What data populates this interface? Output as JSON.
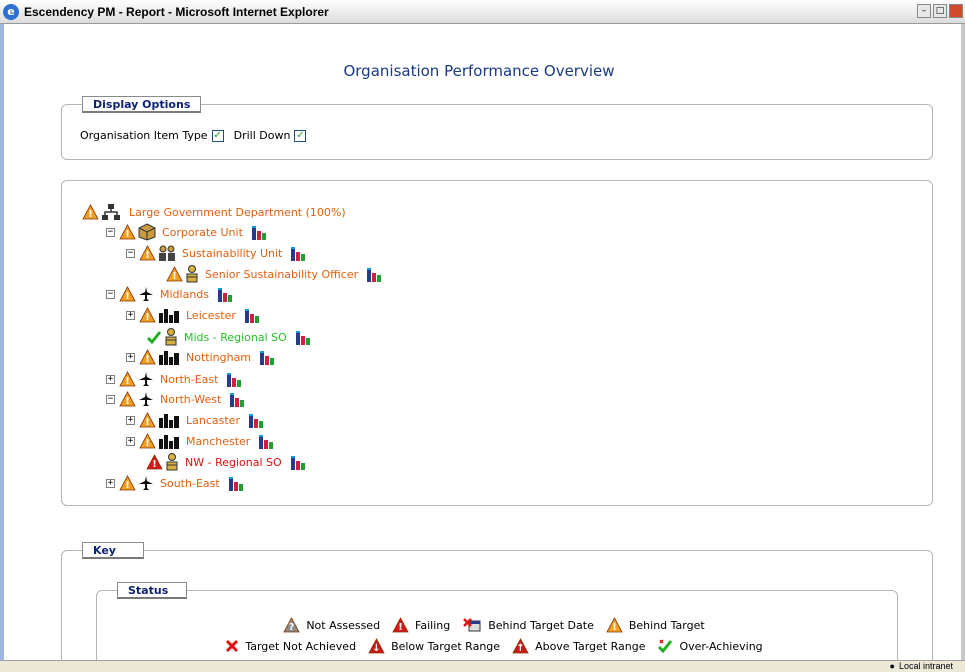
{
  "window": {
    "title": "Escendency PM - Report - Microsoft Internet Explorer"
  },
  "page": {
    "title": "Organisation Performance Overview"
  },
  "display_options": {
    "legend": "Display Options",
    "org_item_type_label": "Organisation Item Type",
    "org_item_type_checked": true,
    "drill_down_label": "Drill Down",
    "drill_down_checked": true
  },
  "tree": [
    {
      "label": "Large Government Department (100%)",
      "status": "behind-target",
      "type": "hierarchy-icon",
      "color": "orange",
      "expander": "",
      "chart": false
    },
    {
      "label": "Corporate Unit",
      "status": "behind-target",
      "type": "box-icon",
      "color": "orange",
      "expander": "minus",
      "chart": true
    },
    {
      "label": "Sustainability Unit",
      "status": "behind-target",
      "type": "group-icon",
      "color": "orange",
      "expander": "minus",
      "chart": true
    },
    {
      "label": "Senior Sustainability Officer",
      "status": "behind-target",
      "type": "person-icon",
      "color": "orange",
      "expander": "",
      "chart": true
    },
    {
      "label": "Midlands",
      "status": "behind-target",
      "type": "plane-icon",
      "color": "orange",
      "expander": "minus",
      "chart": true
    },
    {
      "label": "Leicester",
      "status": "behind-target",
      "type": "city-icon",
      "color": "orange",
      "expander": "plus",
      "chart": true
    },
    {
      "label": "Mids - Regional SO",
      "status": "achieved",
      "type": "person-icon",
      "color": "green",
      "expander": "",
      "chart": true
    },
    {
      "label": "Nottingham",
      "status": "behind-target",
      "type": "city-icon",
      "color": "orange",
      "expander": "plus",
      "chart": true
    },
    {
      "label": "North-East",
      "status": "behind-target",
      "type": "plane-icon",
      "color": "orange",
      "expander": "plus",
      "chart": true
    },
    {
      "label": "North-West",
      "status": "behind-target",
      "type": "plane-icon",
      "color": "orange",
      "expander": "minus",
      "chart": true
    },
    {
      "label": "Lancaster",
      "status": "behind-target",
      "type": "city-icon",
      "color": "orange",
      "expander": "plus",
      "chart": true
    },
    {
      "label": "Manchester",
      "status": "behind-target",
      "type": "city-icon",
      "color": "orange",
      "expander": "plus",
      "chart": true
    },
    {
      "label": "NW - Regional SO",
      "status": "failing",
      "type": "person-icon",
      "color": "red",
      "expander": "",
      "chart": true
    },
    {
      "label": "South-East",
      "status": "behind-target",
      "type": "plane-icon",
      "color": "orange",
      "expander": "plus",
      "chart": true
    }
  ],
  "key": {
    "legend": "Key",
    "status_legend": "Status",
    "row1": [
      {
        "label": "Not Assessed",
        "icon": "not-assessed-icon"
      },
      {
        "label": "Failing",
        "icon": "failing-icon"
      },
      {
        "label": "Behind Target Date",
        "icon": "behind-date-icon"
      },
      {
        "label": "Behind Target",
        "icon": "behind-target-icon"
      }
    ],
    "row2": [
      {
        "label": "Target Not Achieved",
        "icon": "cross-icon"
      },
      {
        "label": "Below Target Range",
        "icon": "below-range-icon"
      },
      {
        "label": "Above Target Range",
        "icon": "above-range-icon"
      },
      {
        "label": "Over-Achieving",
        "icon": "over-achieving-icon"
      }
    ]
  },
  "statusbar": {
    "zone": "Local intranet"
  },
  "colors": {
    "orange": "#e06010",
    "green": "#22c022",
    "red": "#dd1111",
    "title": "#1a3a86"
  }
}
